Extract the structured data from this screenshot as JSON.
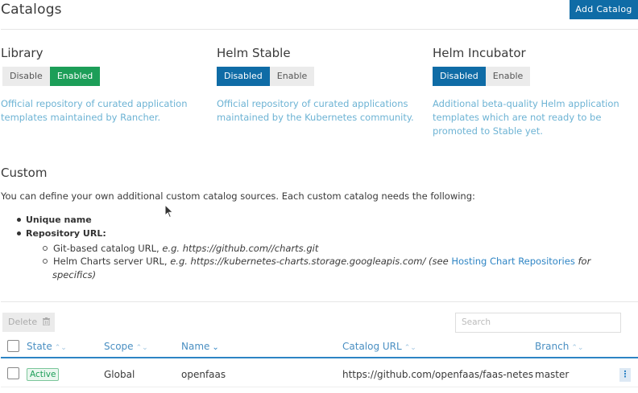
{
  "header": {
    "title": "Catalogs",
    "add_button": "Add Catalog"
  },
  "catalogs": [
    {
      "name": "Library",
      "options": [
        "Disable",
        "Enabled"
      ],
      "selected": "Enabled",
      "description": "Official repository of curated application templates maintained by Rancher."
    },
    {
      "name": "Helm Stable",
      "options": [
        "Disabled",
        "Enable"
      ],
      "selected": "Disabled",
      "description": "Official repository of curated applications maintained by the Kubernetes community."
    },
    {
      "name": "Helm Incubator",
      "options": [
        "Disabled",
        "Enable"
      ],
      "selected": "Disabled",
      "description": "Additional beta-quality Helm application templates which are not ready to be promoted to Stable yet."
    }
  ],
  "custom": {
    "title": "Custom",
    "intro": "You can define your own additional custom catalog sources. Each custom catalog needs the following:",
    "requirements": {
      "unique_name": "Unique name",
      "repo_url": "Repository URL:",
      "git_prefix": "Git-based catalog URL, ",
      "git_example": "e.g. https://github.com//charts.git",
      "helm_prefix": "Helm Charts server URL, ",
      "helm_example": "e.g. https://kubernetes-charts.storage.googleapis.com/",
      "helm_see": " (see ",
      "helm_link": "Hosting Chart Repositories",
      "helm_for": " for",
      "helm_specifics": "specifics)"
    }
  },
  "toolbar": {
    "delete_label": "Delete",
    "search_placeholder": "Search"
  },
  "table": {
    "columns": [
      "State",
      "Scope",
      "Name",
      "Catalog URL",
      "Branch"
    ],
    "rows": [
      {
        "state": "Active",
        "scope": "Global",
        "name": "openfaas",
        "url": "https://github.com/openfaas/faas-netes",
        "branch": "master"
      }
    ]
  },
  "colors": {
    "primary": "#0f6ca6",
    "enabled_green": "#1c9e58",
    "link": "#2d84c4",
    "description": "#6db3d4"
  }
}
